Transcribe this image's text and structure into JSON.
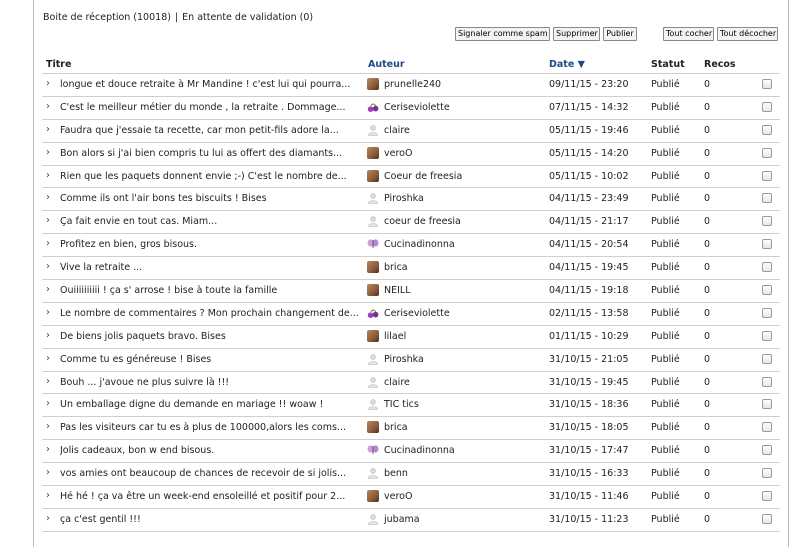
{
  "header": {
    "inbox_label": "Boite de réception (10018)",
    "separator": "|",
    "pending_label": "En attente de validation (0)"
  },
  "toolbar": {
    "spam_label": "Signaler comme spam",
    "delete_label": "Supprimer",
    "publish_label": "Publier",
    "check_all_label": "Tout cocher",
    "uncheck_all_label": "Tout décocher"
  },
  "columns": {
    "title": "Titre",
    "author": "Auteur",
    "date": "Date ▼",
    "status": "Statut",
    "recos": "Recos"
  },
  "rows": [
    {
      "title": "longue et douce retraite à Mr Mandine ! c'est lui qui pourra...",
      "author": "prunelle240",
      "avatar": "photo-avatar",
      "date": "09/11/15 - 23:20",
      "status": "Publié",
      "recos": "0"
    },
    {
      "title": "C'est le meilleur métier du monde , la retraite . Dommage...",
      "author": "Ceriseviolette",
      "avatar": "cherries-avatar",
      "date": "07/11/15 - 14:32",
      "status": "Publié",
      "recos": "0"
    },
    {
      "title": "Faudra que j'essaie ta recette, car mon petit-fils adore la...",
      "author": "claire",
      "avatar": "default-user-avatar",
      "date": "05/11/15 - 19:46",
      "status": "Publié",
      "recos": "0"
    },
    {
      "title": "Bon alors si j'ai bien compris tu lui as offert des diamants...",
      "author": "veroO",
      "avatar": "photo-avatar",
      "date": "05/11/15 - 14:20",
      "status": "Publié",
      "recos": "0"
    },
    {
      "title": "Rien que les paquets donnent envie ;-) C'est le nombre de...",
      "author": "Coeur de freesia",
      "avatar": "photo-avatar",
      "date": "05/11/15 - 10:02",
      "status": "Publié",
      "recos": "0"
    },
    {
      "title": "Comme ils ont l'air bons tes biscuits ! Bises",
      "author": "Piroshka",
      "avatar": "default-user-avatar",
      "date": "04/11/15 - 23:49",
      "status": "Publié",
      "recos": "0"
    },
    {
      "title": "Ça fait envie en tout cas. Miam...",
      "author": "coeur de freesia",
      "avatar": "default-user-avatar",
      "date": "04/11/15 - 21:17",
      "status": "Publié",
      "recos": "0"
    },
    {
      "title": "Profitez en bien, gros bisous.",
      "author": "Cucinadinonna",
      "avatar": "butterfly-avatar",
      "date": "04/11/15 - 20:54",
      "status": "Publié",
      "recos": "0"
    },
    {
      "title": "Vive la retraite ...",
      "author": "brica",
      "avatar": "photo-avatar",
      "date": "04/11/15 - 19:45",
      "status": "Publié",
      "recos": "0"
    },
    {
      "title": "Ouiiiiiiiiii ! ça s' arrose ! bise à toute la famille",
      "author": "NEILL",
      "avatar": "photo-avatar",
      "date": "04/11/15 - 19:18",
      "status": "Publié",
      "recos": "0"
    },
    {
      "title": "Le nombre de commentaires ? Mon prochain changement de...",
      "author": "Ceriseviolette",
      "avatar": "cherries-avatar",
      "date": "02/11/15 - 13:58",
      "status": "Publié",
      "recos": "0"
    },
    {
      "title": "De biens jolis paquets bravo. Bises",
      "author": "lilael",
      "avatar": "photo-avatar",
      "date": "01/11/15 - 10:29",
      "status": "Publié",
      "recos": "0"
    },
    {
      "title": "Comme tu es généreuse ! Bises",
      "author": "Piroshka",
      "avatar": "default-user-avatar",
      "date": "31/10/15 - 21:05",
      "status": "Publié",
      "recos": "0"
    },
    {
      "title": "Bouh ... j'avoue ne plus suivre là !!!",
      "author": "claire",
      "avatar": "default-user-avatar",
      "date": "31/10/15 - 19:45",
      "status": "Publié",
      "recos": "0"
    },
    {
      "title": "Un emballage digne du demande en mariage !! woaw !",
      "author": "TIC tics",
      "avatar": "default-user-avatar",
      "date": "31/10/15 - 18:36",
      "status": "Publié",
      "recos": "0"
    },
    {
      "title": "Pas les visiteurs car tu es à plus de 100000,alors les coms...",
      "author": "brica",
      "avatar": "photo-avatar",
      "date": "31/10/15 - 18:05",
      "status": "Publié",
      "recos": "0"
    },
    {
      "title": "Jolis cadeaux, bon w end bisous.",
      "author": "Cucinadinonna",
      "avatar": "butterfly-avatar",
      "date": "31/10/15 - 17:47",
      "status": "Publié",
      "recos": "0"
    },
    {
      "title": "vos amies ont beaucoup de chances de recevoir de si jolis...",
      "author": "benn",
      "avatar": "default-user-avatar",
      "date": "31/10/15 - 16:33",
      "status": "Publié",
      "recos": "0"
    },
    {
      "title": "Hé hé ! ça va être un week-end ensoleillé et positif pour 2...",
      "author": "veroO",
      "avatar": "photo-avatar",
      "date": "31/10/15 - 11:46",
      "status": "Publié",
      "recos": "0"
    },
    {
      "title": "ça c'est gentil !!!",
      "author": "jubama",
      "avatar": "default-user-avatar",
      "date": "31/10/15 - 11:23",
      "status": "Publié",
      "recos": "0"
    }
  ],
  "colors": {
    "link": "#1a4a8a",
    "border": "#cfcfcf",
    "photo_avatar": "#8a5a3a",
    "cherries_avatar": "#9b3fb5",
    "butterfly_avatar": "#c9a0d8"
  }
}
